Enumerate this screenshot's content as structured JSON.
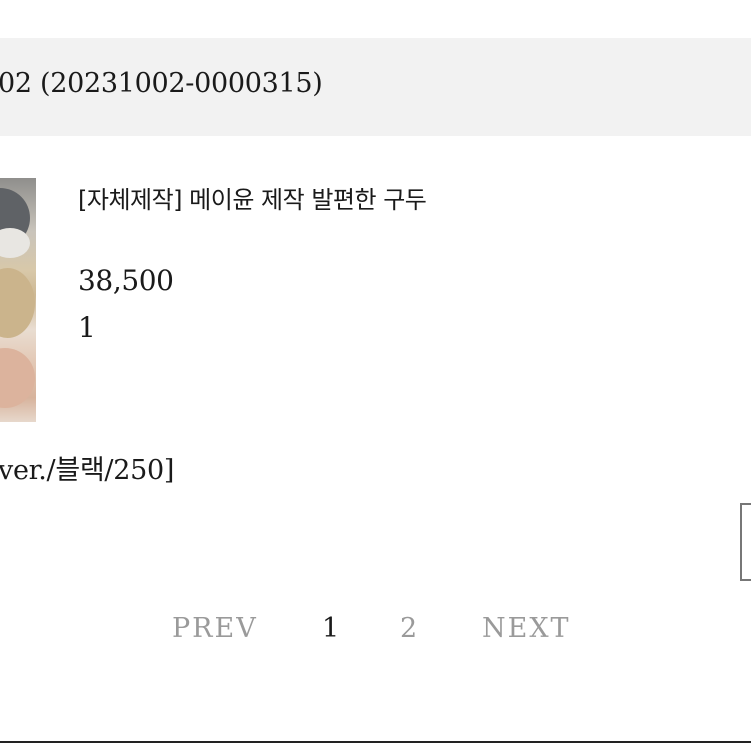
{
  "order": {
    "number_text": "02 (20231002-0000315)"
  },
  "product": {
    "name": "[자체제작] 메이윤 제작 발편한 구두",
    "price": "38,500",
    "quantity": "1",
    "option": "ver./블랙/250]"
  },
  "pagination": {
    "prev_label": "PREV",
    "pages": [
      "1",
      "2"
    ],
    "current_page": "1",
    "next_label": "NEXT"
  },
  "colors": {
    "header_bg": "#f2f2f2",
    "text": "#1a1a1a",
    "muted": "#9a9a9a"
  }
}
